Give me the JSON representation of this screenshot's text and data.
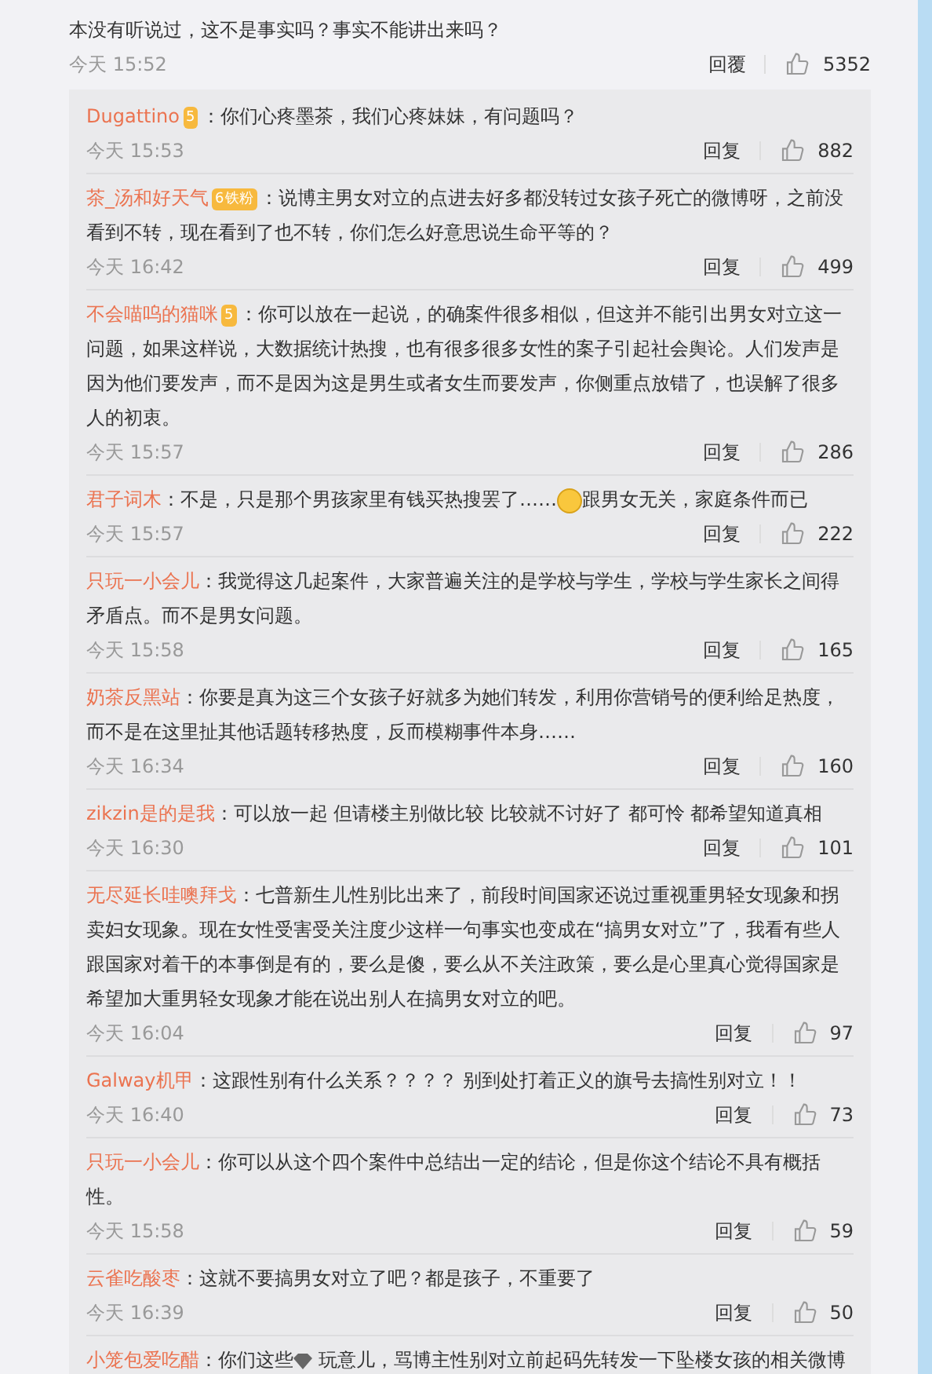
{
  "main_comment": {
    "text": "本没有听说过，这不是事实吗？事实不能讲出来吗？",
    "time": "今天 15:52",
    "reply": "回覆",
    "likes": "5352"
  },
  "replies": [
    {
      "user": "Dugattino",
      "badge": "5",
      "segments": [
        {
          "kind": "text",
          "text": "：你们心疼墨茶，我们心疼妹妹，有问题吗？"
        }
      ],
      "time": "今天 15:53",
      "reply": "回复",
      "likes": "882"
    },
    {
      "user": "茶_汤和好天气",
      "badge": "6",
      "fan": "铁粉",
      "segments": [
        {
          "kind": "text",
          "text": "：说博主男女对立的点进去好多都没转过女孩子死亡的微博呀，之前没看到不转，现在看到了也不转，你们怎么好意思说生命平等的？"
        }
      ],
      "time": "今天 16:42",
      "reply": "回复",
      "likes": "499"
    },
    {
      "user": "不会喵呜的猫咪",
      "badge": "5",
      "segments": [
        {
          "kind": "text",
          "text": "：你可以放在一起说，的确案件很多相似，但这并不能引出男女对立这一问题，如果这样说，大数据统计热搜，也有很多很多女性的案子引起社会舆论。人们发声是因为他们要发声，而不是因为这是男生或者女生而要发声，你侧重点放错了，也误解了很多人的初衷。"
        }
      ],
      "time": "今天 15:57",
      "reply": "回复",
      "likes": "286"
    },
    {
      "user": "君子词木",
      "segments": [
        {
          "kind": "text",
          "text": "：不是，只是那个男孩家里有钱买热搜罢了……"
        },
        {
          "kind": "laugh-emoji"
        },
        {
          "kind": "text",
          "text": "跟男女无关，家庭条件而已"
        }
      ],
      "time": "今天 15:57",
      "reply": "回复",
      "likes": "222"
    },
    {
      "user": "只玩一小会儿",
      "segments": [
        {
          "kind": "text",
          "text": "：我觉得这几起案件，大家普遍关注的是学校与学生，学校与学生家长之间得矛盾点。而不是男女问题。"
        }
      ],
      "time": "今天 15:58",
      "reply": "回复",
      "likes": "165"
    },
    {
      "user": "奶茶反黑站",
      "segments": [
        {
          "kind": "text",
          "text": "：你要是真为这三个女孩子好就多为她们转发，利用你营销号的便利给足热度，而不是在这里扯其他话题转移热度，反而模糊事件本身……"
        }
      ],
      "time": "今天 16:34",
      "reply": "回复",
      "likes": "160"
    },
    {
      "user": "zikzin是的是我",
      "segments": [
        {
          "kind": "text",
          "text": "：可以放一起  但请楼主别做比较  比较就不讨好了  都可怜  都希望知道真相"
        }
      ],
      "time": "今天 16:30",
      "reply": "回复",
      "likes": "101"
    },
    {
      "user": "无尽延长哇噢拜戈",
      "segments": [
        {
          "kind": "text",
          "text": "：七普新生儿性别比出来了，前段时间国家还说过重视重男轻女现象和拐卖妇女现象。现在女性受害受关注度少这样一句事实也变成在“搞男女对立”了，我看有些人跟国家对着干的本事倒是有的，要么是傻，要么从不关注政策，要么是心里真心觉得国家是希望加大重男轻女现象才能在说出别人在搞男女对立的吧。"
        }
      ],
      "time": "今天 16:04",
      "reply": "回复",
      "likes": "97"
    },
    {
      "user": "Galway机甲",
      "segments": [
        {
          "kind": "text",
          "text": "：这跟性别有什么关系？？？？ 别到处打着正义的旗号去搞性别对立！！"
        }
      ],
      "time": "今天 16:40",
      "reply": "回复",
      "likes": "73"
    },
    {
      "user": "只玩一小会儿",
      "segments": [
        {
          "kind": "text",
          "text": "：你可以从这个四个案件中总结出一定的结论，但是你这个结论不具有概括性。"
        }
      ],
      "time": "今天 15:58",
      "reply": "回复",
      "likes": "59"
    },
    {
      "user": "云雀吃酸枣",
      "segments": [
        {
          "kind": "text",
          "text": "：这就不要搞男女对立了吧？都是孩子，不重要了"
        }
      ],
      "time": "今天 16:39",
      "reply": "回复",
      "likes": "50"
    },
    {
      "user": "小笼包爱吃醋",
      "segments": [
        {
          "kind": "text",
          "text": "：你们这些"
        },
        {
          "kind": "gem-emoji"
        },
        {
          "kind": "text",
          "text": " 玩意儿，骂博主性别对立前起码先转发一下坠楼女孩的相关微博"
        }
      ]
    }
  ]
}
